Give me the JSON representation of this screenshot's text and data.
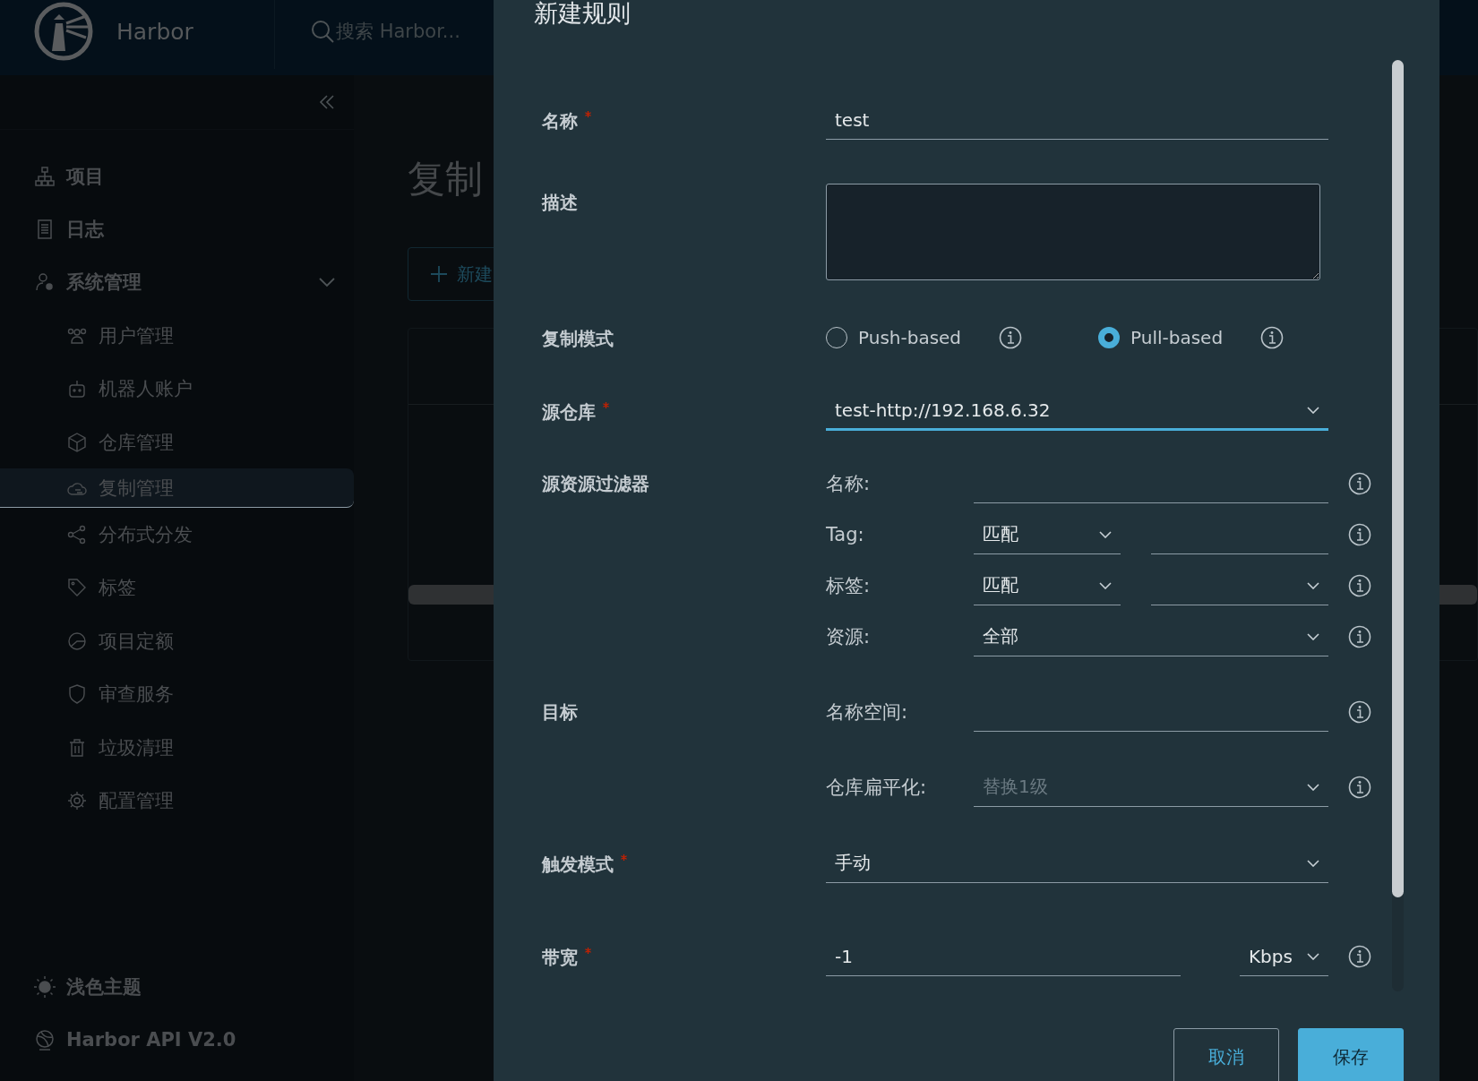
{
  "header": {
    "brand": "Harbor",
    "search_placeholder": "搜索 Harbor..."
  },
  "sidebar": {
    "items": [
      {
        "label": "项目",
        "selected": false
      },
      {
        "label": "日志",
        "selected": false
      },
      {
        "label": "系统管理",
        "selected": false,
        "expanded": true,
        "children": [
          {
            "label": "用户管理",
            "selected": false
          },
          {
            "label": "机器人账户",
            "selected": false
          },
          {
            "label": "仓库管理",
            "selected": false
          },
          {
            "label": "复制管理",
            "selected": true
          },
          {
            "label": "分布式分发",
            "selected": false
          },
          {
            "label": "标签",
            "selected": false
          },
          {
            "label": "项目定额",
            "selected": false
          },
          {
            "label": "审查服务",
            "selected": false
          },
          {
            "label": "垃圾清理",
            "selected": false
          },
          {
            "label": "配置管理",
            "selected": false
          }
        ]
      }
    ],
    "footer": [
      {
        "label": "浅色主题"
      },
      {
        "label": "Harbor API V2.0"
      }
    ]
  },
  "page": {
    "title": "复制",
    "new_button": "新建"
  },
  "modal": {
    "title": "新建规则",
    "rows": [
      {
        "kind": "text",
        "label": "名称",
        "required": true,
        "value": "test"
      },
      {
        "kind": "textarea",
        "label": "描述",
        "required": false
      },
      {
        "kind": "radio",
        "label": "复制模式",
        "required": false,
        "options": [
          {
            "label": "Push-based",
            "selected": false
          },
          {
            "label": "Pull-based",
            "selected": true
          }
        ]
      },
      {
        "kind": "select",
        "label": "源仓库",
        "required": true,
        "value": "test-http://192.168.6.32",
        "focused": true
      },
      {
        "kind": "group",
        "label": "源资源过滤器",
        "required": false,
        "items": [
          {
            "kind": "input",
            "label": "名称:"
          },
          {
            "kind": "select-input",
            "label": "Tag:",
            "value": "匹配"
          },
          {
            "kind": "select-select",
            "label": "标签:",
            "value": "匹配"
          },
          {
            "kind": "select",
            "label": "资源:",
            "value": "全部"
          }
        ]
      },
      {
        "kind": "group",
        "label": "目标",
        "required": false,
        "items": [
          {
            "kind": "input",
            "label": "名称空间:"
          },
          {
            "kind": "select",
            "label": "仓库扁平化:",
            "placeholder": "替换1级"
          }
        ]
      },
      {
        "kind": "select",
        "label": "触发模式",
        "required": true,
        "value": "手动",
        "focused": false
      },
      {
        "kind": "bandwidth",
        "label": "带宽",
        "required": true,
        "value": "-1",
        "unit": "Kbps"
      }
    ],
    "buttons": [
      {
        "label": "取消",
        "kind": "secondary"
      },
      {
        "label": "保存",
        "kind": "primary"
      }
    ]
  }
}
